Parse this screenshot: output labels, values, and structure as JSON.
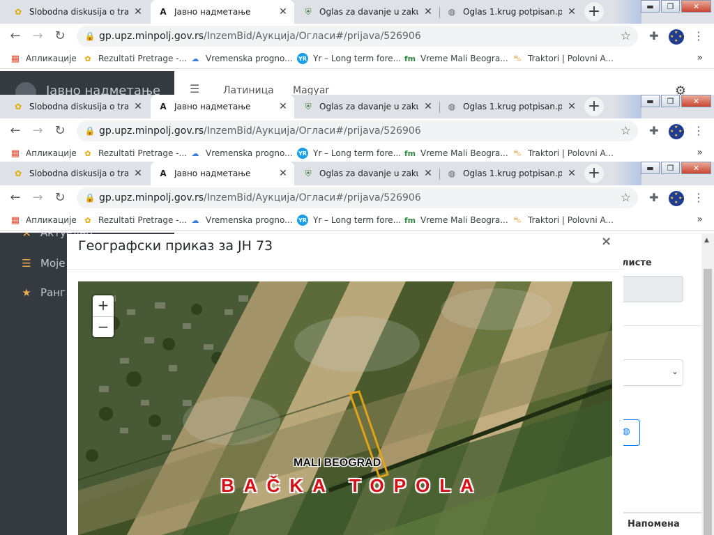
{
  "browser": {
    "tabs": [
      {
        "title": "Slobodna diskusija o trakto",
        "favicon": "sunflower-icon"
      },
      {
        "title": "Јавно надметање",
        "favicon": "app-logo-icon"
      },
      {
        "title": "Oglas za davanje u zakup p",
        "favicon": "municipality-crest-icon"
      },
      {
        "title": "Oglas 1.krug potpisan.pdf",
        "favicon": "globe-icon"
      }
    ],
    "address": {
      "host": "gp.upz.minpolj.gov.rs",
      "path": "/InzemBid/Аукција/Огласи#/prijava/526906"
    },
    "bookmarks": [
      {
        "label": "Апликације",
        "icon": "apps-grid-icon"
      },
      {
        "label": "Rezultati Pretrage -...",
        "icon": "sunflower-icon"
      },
      {
        "label": "Vremenska progno...",
        "icon": "weather-icon"
      },
      {
        "label": "Yr – Long term fore...",
        "icon": "yr-icon"
      },
      {
        "label": "Vreme Mali Beogra...",
        "icon": "fm-icon"
      },
      {
        "label": "Traktori | Polovni A...",
        "icon": "car-icon"
      }
    ],
    "bookmarks_more": "»"
  },
  "page": {
    "app_title": "Јавно надметање",
    "nav_links": [
      "Латиница",
      "Magyar"
    ],
    "sidebar_items": [
      {
        "label": "Актуелно",
        "icon": "gavel-icon"
      },
      {
        "label": "Моје пријаве",
        "icon": "list-icon"
      },
      {
        "label": "Ранг листа",
        "icon": "star-icon"
      }
    ],
    "right_panel": {
      "label": "листе",
      "table_header": "Напомена"
    }
  },
  "modal": {
    "title": "Географски приказ за ЈН 73",
    "close": "×",
    "zoom_in": "+",
    "zoom_out": "−",
    "map_label_village": "MALI BEOGRAD",
    "map_label_municipality": "BAČKA TOPOLA",
    "parcel_color": "#e2a31a",
    "municipality_label_color": "#d40e14"
  }
}
